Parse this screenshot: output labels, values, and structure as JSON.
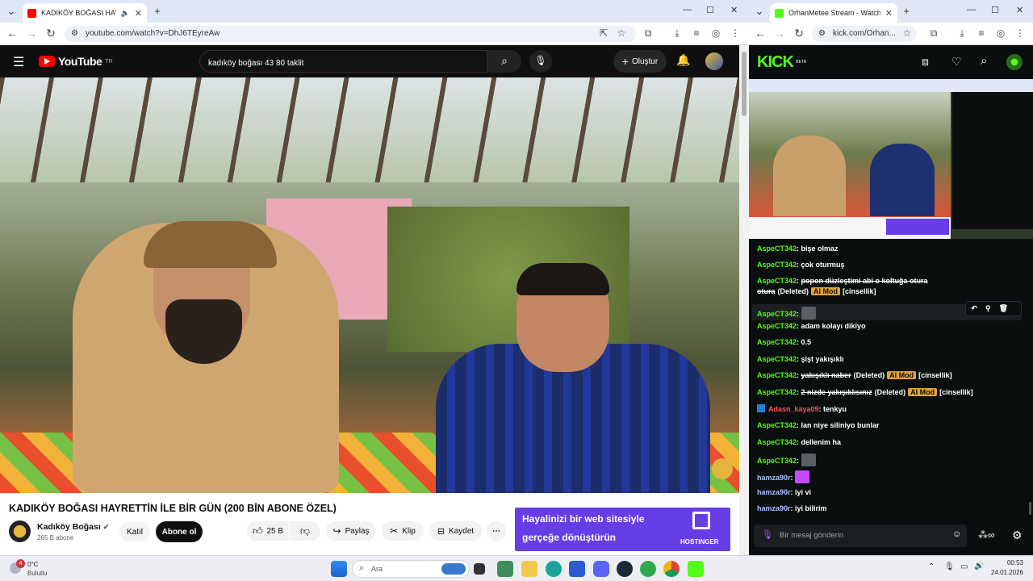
{
  "left_window": {
    "tab_title": "KADIKÖY BOĞASI HAYRETTİ",
    "url": "youtube.com/watch?v=DhJ6TEyreAw",
    "youtube": {
      "logo_text": "YouTube",
      "region": "TR",
      "search_value": "kadıköy boğası 43 80 taklit",
      "create_label": "Oluştur",
      "video_title": "KADIKÖY BOĞASI HAYRETTİN İLE BİR GÜN (200 BİN ABONE ÖZEL)",
      "channel_name": "Kadıköy Boğası",
      "subscribers": "265 B abone",
      "join_label": "Katıl",
      "subscribe_label": "Abone ol",
      "like_count": "25 B",
      "share_label": "Paylaş",
      "clip_label": "Klip",
      "save_label": "Kaydet",
      "ad_line1": "Hayalinizi bir web sitesiyle",
      "ad_line2": "gerçeğe dönüştürün",
      "ad_brand": "HOSTINGER"
    }
  },
  "right_window": {
    "tab_title": "OrhanMetee Stream - Watch Li",
    "url": "kick.com/Orhan...",
    "kick": {
      "logo_text": "KICK",
      "logo_badge": "BETA",
      "chat_placeholder": "Bir mesaj gönderin",
      "messages": [
        {
          "user": "AspeCT342",
          "text": "bişe olmaz",
          "deleted": false
        },
        {
          "user": "AspeCT342",
          "text": "çok oturmuş",
          "deleted": false
        },
        {
          "user": "AspeCT342",
          "text": "popon düzleştimi abi o koltuğa otura",
          "text2": "otura",
          "deleted": true,
          "deleted_label": "(Deleted)",
          "mod_label": "AI Mod",
          "reason": "[cinsellik]"
        },
        {
          "user": "AspeCT342",
          "text": "",
          "deleted": false
        },
        {
          "user": "AspeCT342",
          "text": "adam kolayı dikiyo",
          "deleted": false
        },
        {
          "user": "AspeCT342",
          "text": "0.5",
          "deleted": false
        },
        {
          "user": "AspeCT342",
          "text": "şişt yakışıklı",
          "deleted": false
        },
        {
          "user": "AspeCT342",
          "text": "yakışıklı naber",
          "deleted": true,
          "deleted_label": "(Deleted)",
          "mod_label": "AI Mod",
          "reason": "[cinsellik]"
        },
        {
          "user": "AspeCT342",
          "text": "2 nizde yakışıklısınız",
          "deleted": true,
          "deleted_label": "(Deleted)",
          "mod_label": "AI Mod",
          "reason": "[cinsellik]"
        },
        {
          "user": "Adasn_kaya09",
          "text": "tenkyu",
          "deleted": false
        },
        {
          "user": "AspeCT342",
          "text": "lan niye siliniyo bunlar",
          "deleted": false
        },
        {
          "user": "AspeCT342",
          "text": "dellenim ha",
          "deleted": false
        },
        {
          "user": "AspeCT342",
          "text": "",
          "deleted": false
        },
        {
          "user": "hamza90r",
          "text": "",
          "deleted": false
        },
        {
          "user": "hamza90r",
          "text": "iyi vi",
          "deleted": false
        },
        {
          "user": "hamza90r",
          "text": "iyi bilirim",
          "deleted": false
        }
      ]
    }
  },
  "taskbar": {
    "weather_temp": "0°C",
    "weather_desc": "Bulutlu",
    "weather_badge": "4",
    "search_placeholder": "Ara",
    "time": "00:53",
    "date": "24.01.2026"
  },
  "colors": {
    "youtube_red": "#ff0000",
    "kick_green": "#53fc18",
    "ai_mod": "#e3a33b"
  }
}
